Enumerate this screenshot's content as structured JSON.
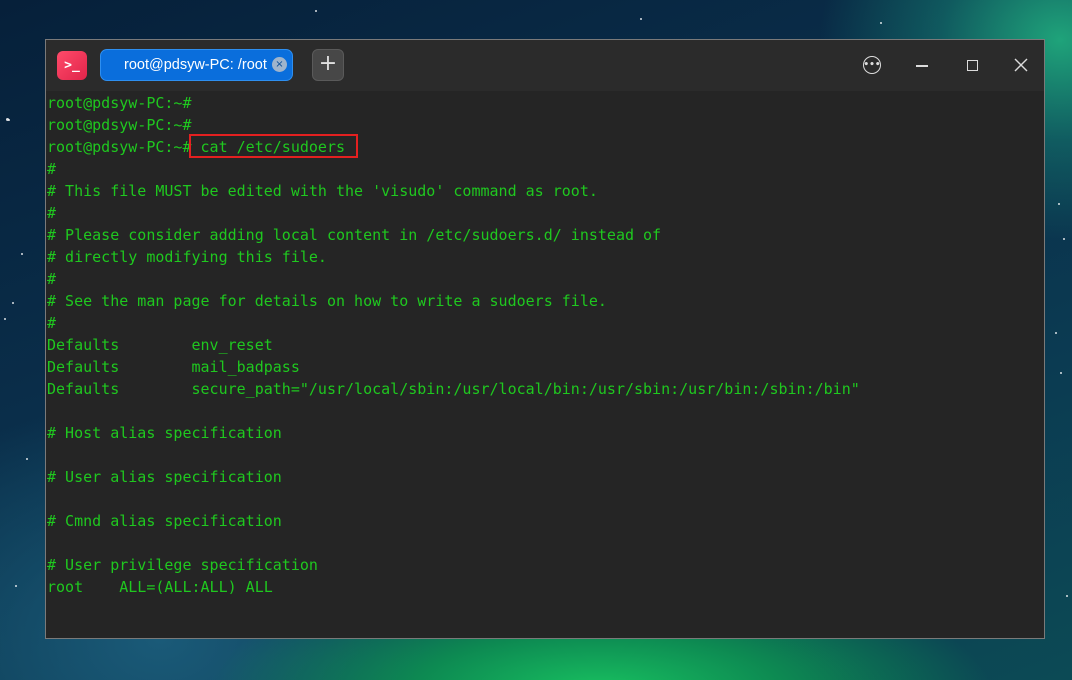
{
  "window": {
    "app_icon_glyph": ">_",
    "tab_title": "root@pdsyw-PC: /root",
    "tab_close_glyph": "×",
    "new_tab_glyph": "+",
    "menu_glyph": "•••",
    "colors": {
      "terminal_text": "#1fc81f",
      "terminal_bg": "#252525",
      "tab_active": "#0a6edc",
      "highlight_box": "#e32020"
    }
  },
  "terminal": {
    "lines": [
      "root@pdsyw-PC:~#",
      "root@pdsyw-PC:~#",
      "root@pdsyw-PC:~# cat /etc/sudoers",
      "#",
      "# This file MUST be edited with the 'visudo' command as root.",
      "#",
      "# Please consider adding local content in /etc/sudoers.d/ instead of",
      "# directly modifying this file.",
      "#",
      "# See the man page for details on how to write a sudoers file.",
      "#",
      "Defaults        env_reset",
      "Defaults        mail_badpass",
      "Defaults        secure_path=\"/usr/local/sbin:/usr/local/bin:/usr/sbin:/usr/bin:/sbin:/bin\"",
      "",
      "# Host alias specification",
      "",
      "# User alias specification",
      "",
      "# Cmnd alias specification",
      "",
      "# User privilege specification",
      "root    ALL=(ALL:ALL) ALL"
    ]
  }
}
